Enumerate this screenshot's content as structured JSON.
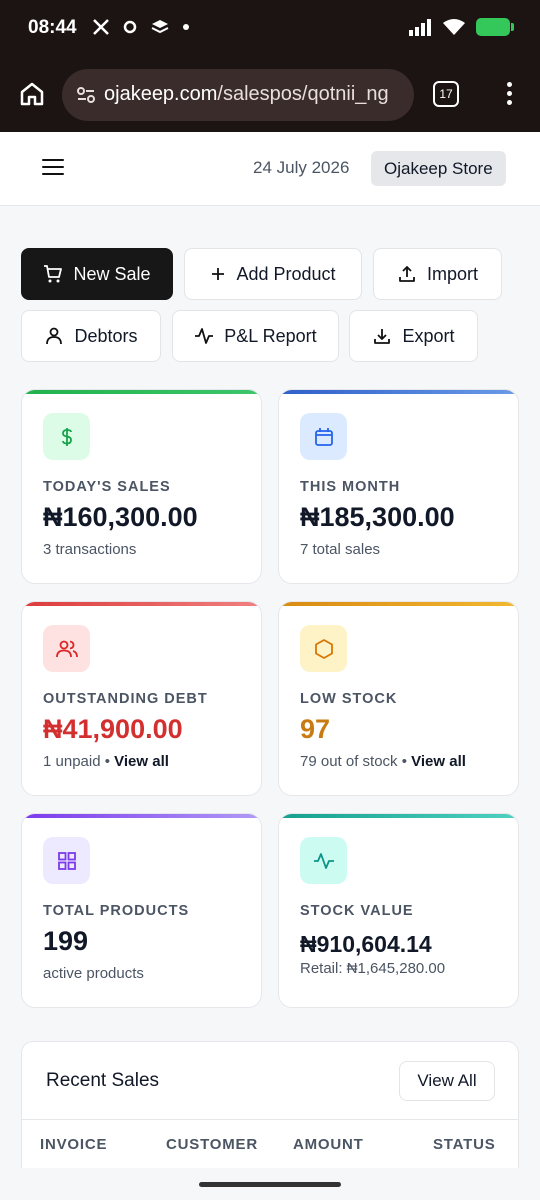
{
  "status_bar": {
    "time": "08:44",
    "battery_color": "#34c759"
  },
  "browser": {
    "url_host": "ojakeep.com",
    "url_path": "/salespos/qotnii_ng",
    "tab_count": "17"
  },
  "header": {
    "date": "24 July 2026",
    "store_name": "Ojakeep Store"
  },
  "actions": {
    "new_sale": "New Sale",
    "add_product": "Add Product",
    "import": "Import",
    "debtors": "Debtors",
    "pl_report": "P&L Report",
    "export": "Export"
  },
  "cards": {
    "todays_sales": {
      "label": "TODAY'S SALES",
      "value": "₦160,300.00",
      "sub": "3 transactions",
      "accent": "#22b14c",
      "icon": "dollar-icon"
    },
    "this_month": {
      "label": "THIS MONTH",
      "value": "₦185,300.00",
      "sub": "7 total sales",
      "accent": "#3b6fd8",
      "icon": "calendar-icon"
    },
    "outstanding_debt": {
      "label": "OUTSTANDING DEBT",
      "value": "₦41,900.00",
      "sub": "1 unpaid",
      "link": "View all",
      "accent": "#dc3b3b",
      "icon": "users-icon"
    },
    "low_stock": {
      "label": "LOW STOCK",
      "value": "97",
      "sub": "79 out of stock",
      "link": "View all",
      "accent": "#e0a020",
      "icon": "hexagon-icon"
    },
    "total_products": {
      "label": "TOTAL PRODUCTS",
      "value": "199",
      "sub": "active products",
      "accent": "#8b5cf6",
      "icon": "grid-icon"
    },
    "stock_value": {
      "label": "STOCK VALUE",
      "value": "₦910,604.14",
      "sub": "Retail: ₦1,645,280.00",
      "accent": "#20b2a0",
      "icon": "activity-icon"
    }
  },
  "recent_sales": {
    "title": "Recent Sales",
    "view_all": "View All",
    "columns": [
      "INVOICE",
      "CUSTOMER",
      "AMOUNT",
      "STATUS"
    ]
  }
}
